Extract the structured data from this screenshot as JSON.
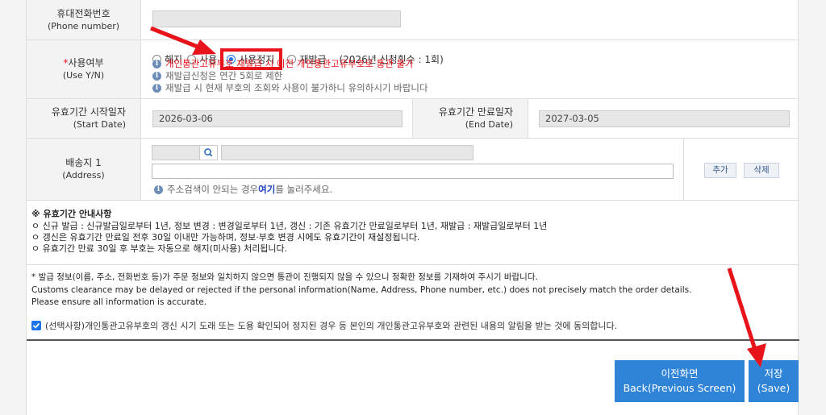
{
  "phone": {
    "label": "휴대전화번호",
    "sublabel": "(Phone number)",
    "value": ""
  },
  "use": {
    "label_star": "*",
    "label": "사용여부",
    "sublabel": "(Use Y/N)",
    "options": [
      {
        "label": "해지",
        "selected": false
      },
      {
        "label": "사용",
        "selected": false
      },
      {
        "label": "사용정지",
        "selected": true
      },
      {
        "label": "재발급",
        "selected": false
      }
    ],
    "reissue_count": "(2026년 신청횟수 : 1회)",
    "notes": [
      "개인통관고유부호 재발급 시 이전 개인통관고유부호로 통관 불가",
      "재발급신청은 연간 5회로 제한",
      "재발급 시 현재 부호의 조회와 사용이 불가하니 유의하시기 바랍니다"
    ]
  },
  "dates": {
    "start_label": "유효기간 시작일자",
    "start_sub": "(Start Date)",
    "start_value": "2026-03-06",
    "end_label": "유효기간 만료일자",
    "end_sub": "(End Date)",
    "end_value": "2027-03-05"
  },
  "address": {
    "label": "배송지 1",
    "sublabel": "(Address)",
    "zip": "",
    "addr1": "",
    "addr2": "",
    "hint_pre": "주소검색이 안되는 경우 ",
    "hint_link": "여기",
    "hint_post": "를 눌러주세요.",
    "add_label": "추가",
    "delete_label": "삭제"
  },
  "guide": {
    "title": "※ 유효기간 안내사항",
    "lines": [
      "ㅇ  신규 발급 : 신규발급일로부터 1년, 정보 변경 : 변경일로부터 1년, 갱신 : 기존 유효기간 만료일로부터 1년, 재발급 : 재발급일로부터 1년",
      "ㅇ  갱신은 유효기간 만료일 전후 30일 이내만 가능하며, 정보·부호 변경 시에도 유효기간이 재설정됩니다.",
      "ㅇ  유효기간 만료 30일 후 부호는 자동으로 해지(미사용) 처리됩니다."
    ]
  },
  "notice": {
    "lines": [
      "* 발급 정보(이름, 주소, 전화번호 등)가 주문 정보와 일치하지 않으면 통관이 진행되지 않을 수 있으니 정확한 정보를 기재하여 주시기 바랍니다.",
      "Customs clearance may be delayed or rejected if the personal information(Name, Address, Phone number, etc.) does not precisely match the order details.",
      "Please ensure all information is accurate."
    ]
  },
  "consent": {
    "checked": true,
    "text": "(선택사항)개인통관고유부호의 갱신 시기 도래 또는 도용 확인되어 정지된 경우 등 본인의 개인통관고유부호와 관련된 내용의 알림을 받는 것에 동의합니다."
  },
  "buttons": {
    "back_ko": "이전화면",
    "back_en": "Back(Previous Screen)",
    "save_ko": "저장",
    "save_en": "(Save)"
  },
  "colors": {
    "accent_blue": "#2f84d8",
    "highlight_red": "#e8141c",
    "label_bg": "#f3f3f3"
  }
}
